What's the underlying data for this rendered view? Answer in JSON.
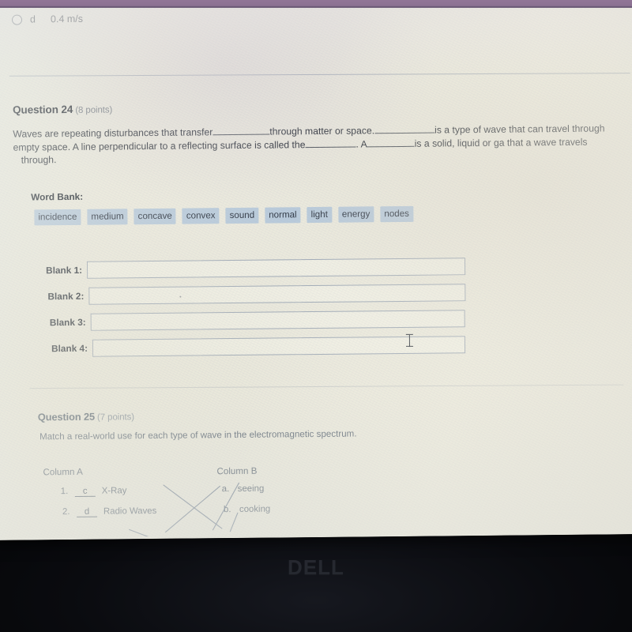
{
  "device": {
    "bezel_brand": "DELL",
    "bezel_color": "#0a0b0f"
  },
  "screen": {
    "background_color": "#eceade",
    "top_band_color": "#94789a"
  },
  "previous_question_tail": {
    "option_letter": "d",
    "option_value": "0.4 m/s",
    "radio_state": "unselected"
  },
  "question24": {
    "title": "Question 24",
    "points": "(8 points)",
    "body_line1_a": "Waves are repeating disturbances that transfer",
    "body_line1_b": "through matter or space.",
    "body_line1_c": "is a type of wave that can travel through",
    "body_line2_a": "empty space. A line perpendicular to a reflecting  surface is called the",
    "body_line2_b": ". A",
    "body_line2_c": "is a solid, liquid or ga that a wave travels",
    "body_line3": "through.",
    "word_bank_label": "Word Bank:",
    "word_bank": [
      "incidence",
      "medium",
      "concave",
      "convex",
      "sound",
      "normal",
      "light",
      "energy",
      "nodes"
    ],
    "blanks": [
      {
        "label": "Blank 1:",
        "value": ""
      },
      {
        "label": "Blank 2:",
        "value": ""
      },
      {
        "label": "Blank 3:",
        "value": ""
      },
      {
        "label": "Blank 4:",
        "value": ""
      }
    ]
  },
  "question25": {
    "title": "Question 25",
    "points": "(7 points)",
    "instructions": "Match a real-world use for each type of wave in the electromagnetic spectrum.",
    "column_a_header": "Column A",
    "column_b_header": "Column B",
    "column_a": [
      {
        "number": "1.",
        "answer": "c",
        "item": "X-Ray"
      },
      {
        "number": "2.",
        "answer": "d",
        "item": "Radio Waves"
      }
    ],
    "column_b": [
      {
        "letter": "a.",
        "item": "seeing"
      },
      {
        "letter": "b.",
        "item": "cooking"
      }
    ]
  },
  "cursor": {
    "type": "text-ibeam"
  }
}
